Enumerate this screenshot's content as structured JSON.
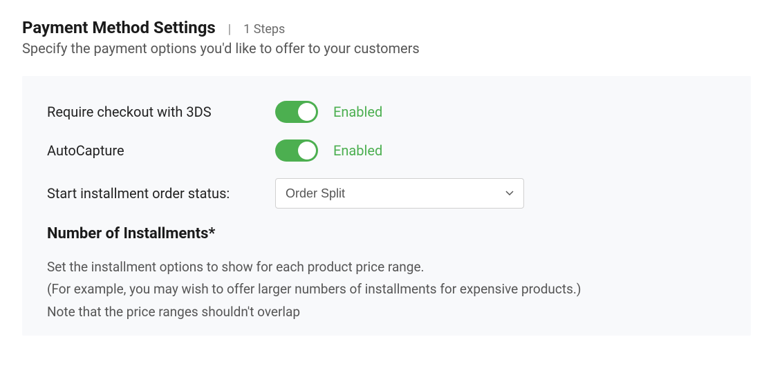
{
  "header": {
    "title": "Payment Method Settings",
    "separator": "|",
    "steps": "1 Steps",
    "subtitle": "Specify the payment options you'd like to offer to your customers"
  },
  "settings": {
    "threeDS": {
      "label": "Require checkout with 3DS",
      "status": "Enabled"
    },
    "autoCapture": {
      "label": "AutoCapture",
      "status": "Enabled"
    },
    "installmentStatus": {
      "label": "Start installment order status:",
      "selected": "Order Split"
    }
  },
  "installments": {
    "title": "Number of Installments*",
    "line1": "Set the installment options to show for each product price range.",
    "line2": "(For example, you may wish to offer larger numbers of installments for expensive products.)",
    "line3": "Note that the price ranges shouldn't overlap"
  }
}
